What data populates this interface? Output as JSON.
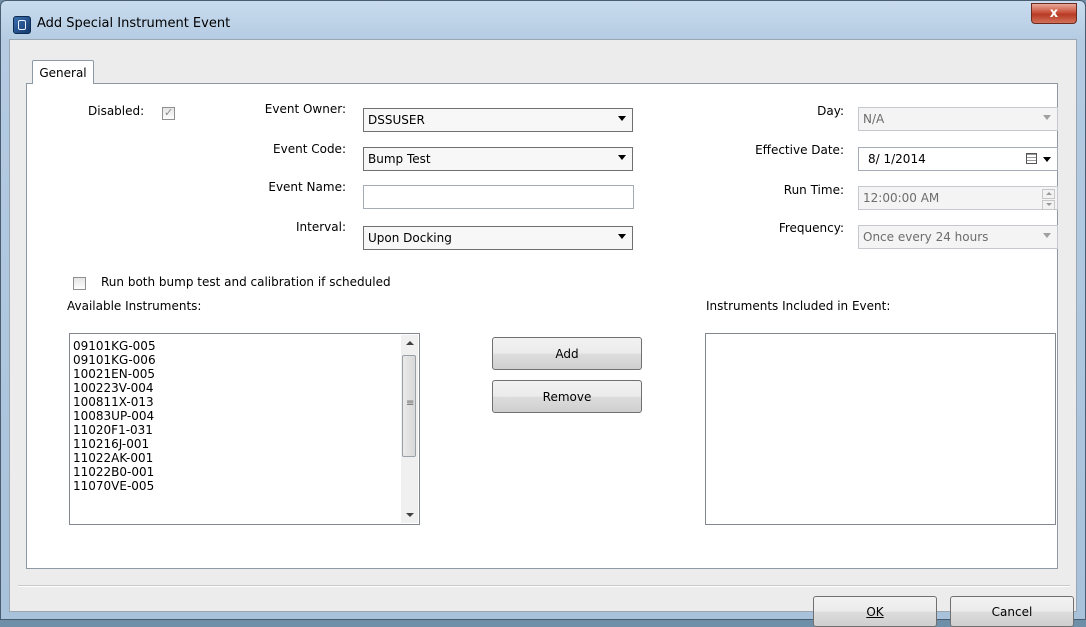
{
  "window": {
    "title": "Add Special Instrument Event",
    "close_label": "x"
  },
  "tabs": [
    {
      "label": "General"
    }
  ],
  "form": {
    "disabled_label": "Disabled:",
    "disabled_checked": true,
    "event_owner_label": "Event Owner:",
    "event_owner_value": "DSSUSER",
    "event_code_label": "Event Code:",
    "event_code_value": "Bump Test",
    "event_name_label": "Event Name:",
    "event_name_value": "",
    "interval_label": "Interval:",
    "interval_value": "Upon Docking",
    "day_label": "Day:",
    "day_value": "N/A",
    "effective_date_label": "Effective Date:",
    "effective_date_value": "8/ 1/2014",
    "run_time_label": "Run Time:",
    "run_time_value": "12:00:00 AM",
    "frequency_label": "Frequency:",
    "frequency_value": "Once every 24 hours",
    "run_both_label": "Run both bump test and calibration if scheduled",
    "run_both_checked": false
  },
  "available": {
    "label": "Available Instruments:",
    "items": [
      "09101KG-005",
      "09101KG-006",
      "10021EN-005",
      "100223V-004",
      "100811X-013",
      "10083UP-004",
      "11020F1-031",
      "110216J-001",
      "11022AK-001",
      "11022B0-001",
      "11070VE-005"
    ]
  },
  "included": {
    "label": "Instruments Included in Event:",
    "items": []
  },
  "buttons": {
    "add": "Add",
    "remove": "Remove",
    "ok": "OK",
    "cancel": "Cancel"
  }
}
